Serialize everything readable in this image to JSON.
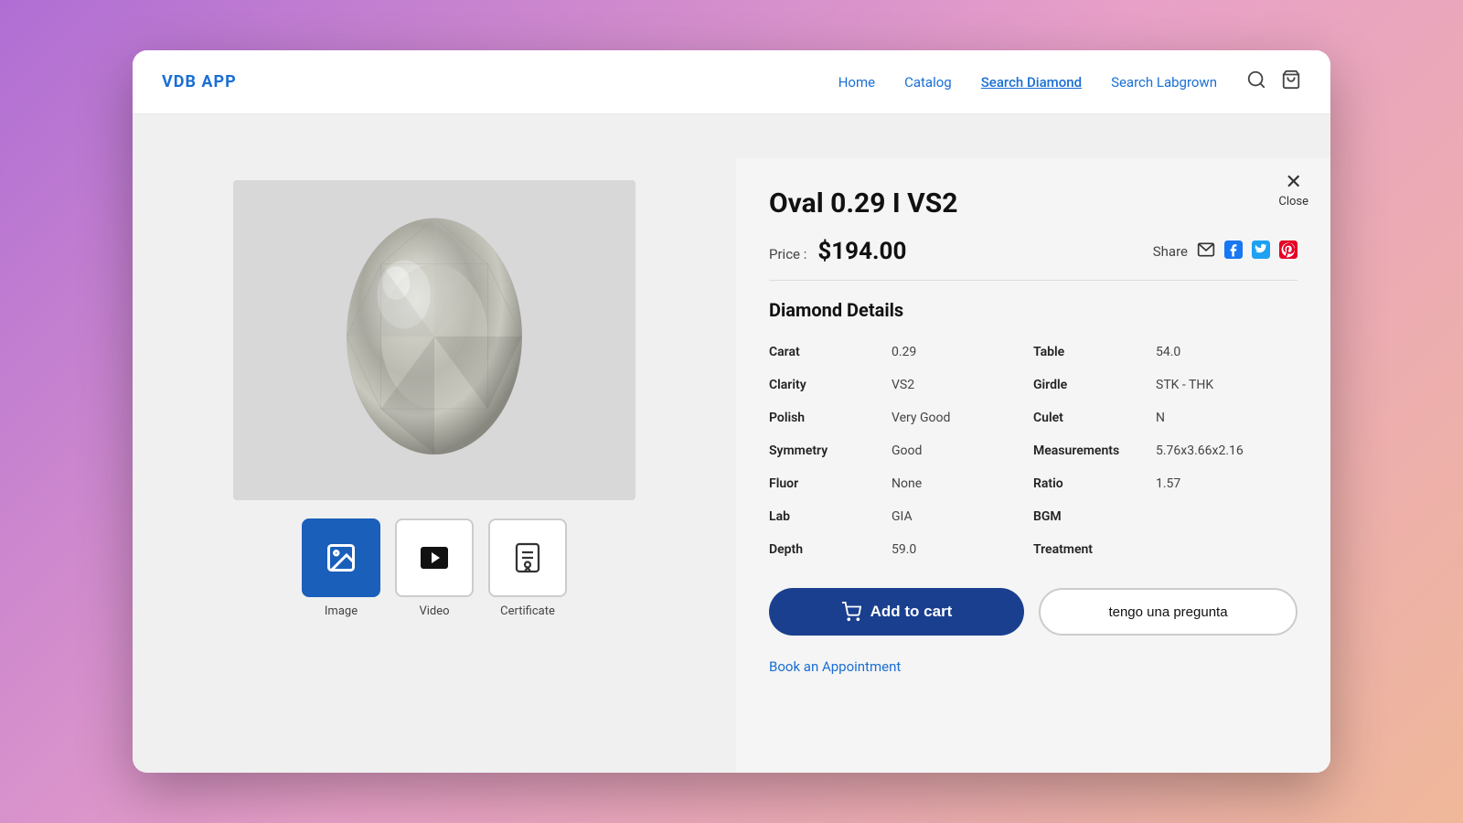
{
  "app": {
    "logo": "VDB APP"
  },
  "nav": {
    "items": [
      {
        "label": "Home",
        "active": false
      },
      {
        "label": "Catalog",
        "active": false
      },
      {
        "label": "Search Diamond",
        "active": true
      },
      {
        "label": "Search Labgrown",
        "active": false
      }
    ]
  },
  "close_button": {
    "label": "Close"
  },
  "diamond": {
    "title": "Oval 0.29 I VS2",
    "price_label": "Price :",
    "price": "$194.00",
    "share_label": "Share",
    "details_title": "Diamond Details",
    "details": [
      {
        "key": "Carat",
        "value": "0.29"
      },
      {
        "key": "Table",
        "value": "54.0"
      },
      {
        "key": "Clarity",
        "value": "VS2"
      },
      {
        "key": "Girdle",
        "value": "STK - THK"
      },
      {
        "key": "Polish",
        "value": "Very Good"
      },
      {
        "key": "Culet",
        "value": "N"
      },
      {
        "key": "Symmetry",
        "value": "Good"
      },
      {
        "key": "Measurements",
        "value": "5.76x3.66x2.16"
      },
      {
        "key": "Fluor",
        "value": "None"
      },
      {
        "key": "Ratio",
        "value": "1.57"
      },
      {
        "key": "Lab",
        "value": "GIA"
      },
      {
        "key": "BGM",
        "value": ""
      },
      {
        "key": "Depth",
        "value": "59.0"
      },
      {
        "key": "Treatment",
        "value": ""
      }
    ]
  },
  "buttons": {
    "add_to_cart": "Add to cart",
    "question": "tengo una pregunta",
    "appointment": "Book an Appointment"
  },
  "media": {
    "tabs": [
      {
        "label": "Image",
        "active": true
      },
      {
        "label": "Video",
        "active": false
      },
      {
        "label": "Certificate",
        "active": false
      }
    ]
  }
}
